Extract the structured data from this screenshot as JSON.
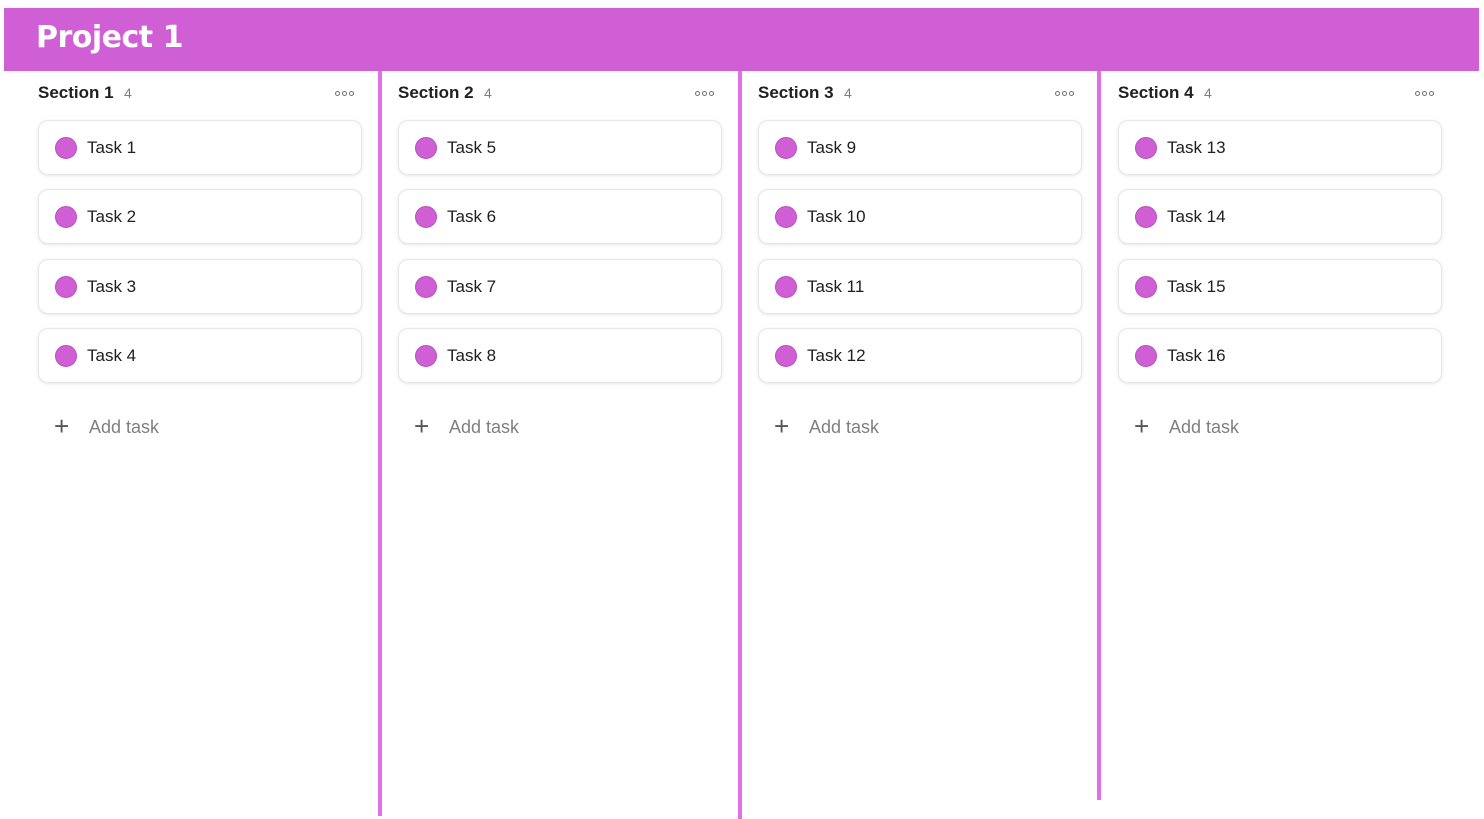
{
  "project": {
    "title": "Project 1"
  },
  "accent_color": "#d05ed5",
  "sections": [
    {
      "title": "Section 1",
      "count": "4",
      "more_icon": "more-horizontal-icon",
      "tasks": [
        {
          "label": "Task 1"
        },
        {
          "label": "Task 2"
        },
        {
          "label": "Task 3"
        },
        {
          "label": "Task 4"
        }
      ],
      "add_task_label": "Add task"
    },
    {
      "title": "Section 2",
      "count": "4",
      "more_icon": "more-horizontal-icon",
      "tasks": [
        {
          "label": "Task 5"
        },
        {
          "label": "Task 6"
        },
        {
          "label": "Task 7"
        },
        {
          "label": "Task 8"
        }
      ],
      "add_task_label": "Add task"
    },
    {
      "title": "Section 3",
      "count": "4",
      "more_icon": "more-horizontal-icon",
      "tasks": [
        {
          "label": "Task 9"
        },
        {
          "label": "Task 10"
        },
        {
          "label": "Task 11"
        },
        {
          "label": "Task 12"
        }
      ],
      "add_task_label": "Add task"
    },
    {
      "title": "Section 4",
      "count": "4",
      "more_icon": "more-horizontal-icon",
      "tasks": [
        {
          "label": "Task 13"
        },
        {
          "label": "Task 14"
        },
        {
          "label": "Task 15"
        },
        {
          "label": "Task 16"
        }
      ],
      "add_task_label": "Add task"
    }
  ]
}
